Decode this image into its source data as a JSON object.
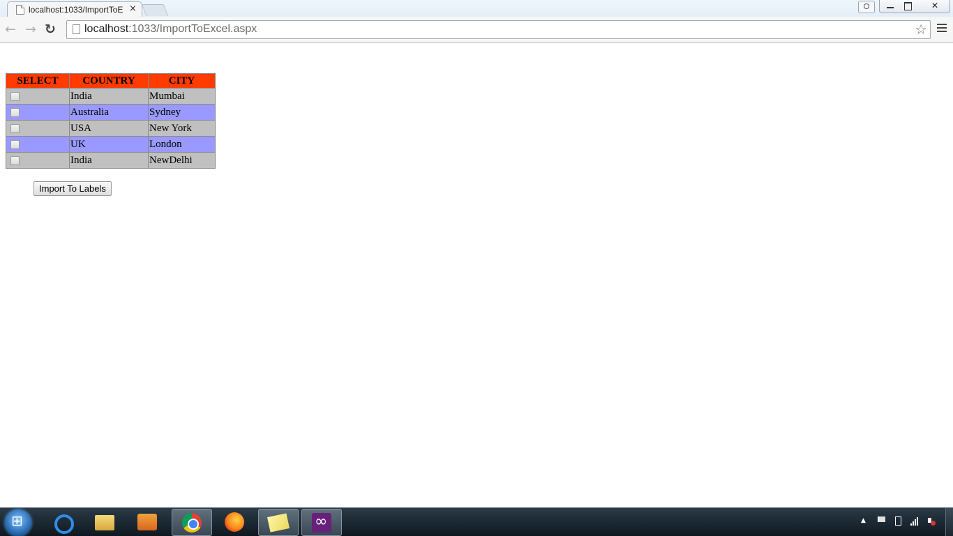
{
  "browser": {
    "tab_title": "localhost:1033/ImportToE",
    "tab_close": "×",
    "url_host": "localhost",
    "url_rest": ":1033/ImportToExcel.aspx",
    "back": "←",
    "forward": "→",
    "reload": "↻",
    "star": "☆",
    "window_close": "✕"
  },
  "grid": {
    "headers": [
      "SELECT",
      "COUNTRY",
      "CITY"
    ],
    "header_color": "#ff3b00",
    "odd_row_color": "#c0c0c0",
    "even_row_color": "#9999ff",
    "rows": [
      {
        "checked": false,
        "country": "India",
        "city": "Mumbai"
      },
      {
        "checked": false,
        "country": "Australia",
        "city": "Sydney"
      },
      {
        "checked": false,
        "country": "USA",
        "city": "New York"
      },
      {
        "checked": false,
        "country": "UK",
        "city": "London"
      },
      {
        "checked": false,
        "country": "India",
        "city": "NewDelhi"
      }
    ]
  },
  "import_button": "Import To Labels",
  "taskbar": {
    "apps": [
      "internet-explorer",
      "windows-explorer",
      "media-player",
      "chrome",
      "firefox",
      "sticky-notes",
      "visual-studio"
    ],
    "active_apps": [
      "chrome",
      "sticky-notes",
      "visual-studio"
    ]
  },
  "tray": {
    "arrow": "▲"
  }
}
